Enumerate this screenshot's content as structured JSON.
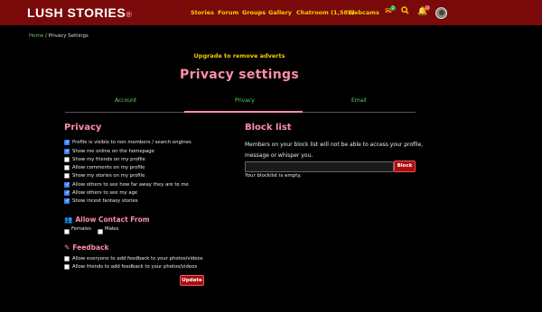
{
  "header": {
    "logo": "LUSH STORIES",
    "logo_tag": "®",
    "nav": [
      "Stories",
      "Forum",
      "Groups",
      "Gallery",
      "Chatroom (1,582)",
      "Webcams"
    ],
    "mail_badge": "2",
    "bell_badge": "10"
  },
  "breadcrumb": {
    "home": "Home",
    "sep": "/",
    "current": "Privacy Settings"
  },
  "upgrade_link": "Upgrade to remove adverts",
  "page_title": "Privacy settings",
  "tabs": [
    "Account",
    "Privacy",
    "Email"
  ],
  "privacy": {
    "heading": "Privacy",
    "options": [
      {
        "label": "Profile is visible to non members / search engines",
        "checked": true
      },
      {
        "label": "Show me online on the homepage",
        "checked": true
      },
      {
        "label": "Show my friends on my profile",
        "checked": false
      },
      {
        "label": "Allow comments on my profile",
        "checked": false
      },
      {
        "label": "Show my stories on my profile",
        "checked": false
      },
      {
        "label": "Allow others to see how far away they are to me",
        "checked": true
      },
      {
        "label": "Allow others to see my age",
        "checked": true
      },
      {
        "label": "Show incest fantasy stories",
        "checked": true
      }
    ]
  },
  "contact": {
    "heading": "Allow Contact From",
    "females": "Females",
    "males": "Males"
  },
  "feedback": {
    "heading": "Feedback",
    "options": [
      {
        "label": "Allow everyone to add feedback to your photos/videos",
        "checked": false
      },
      {
        "label": "Allow friends to add feedback to your photos/videos",
        "checked": false
      }
    ]
  },
  "update_label": "Update",
  "block": {
    "heading": "Block list",
    "description": "Members on your block list will not be able to access your profile, message or whisper you.",
    "button": "Block",
    "empty": "Your blocklist is empty."
  }
}
